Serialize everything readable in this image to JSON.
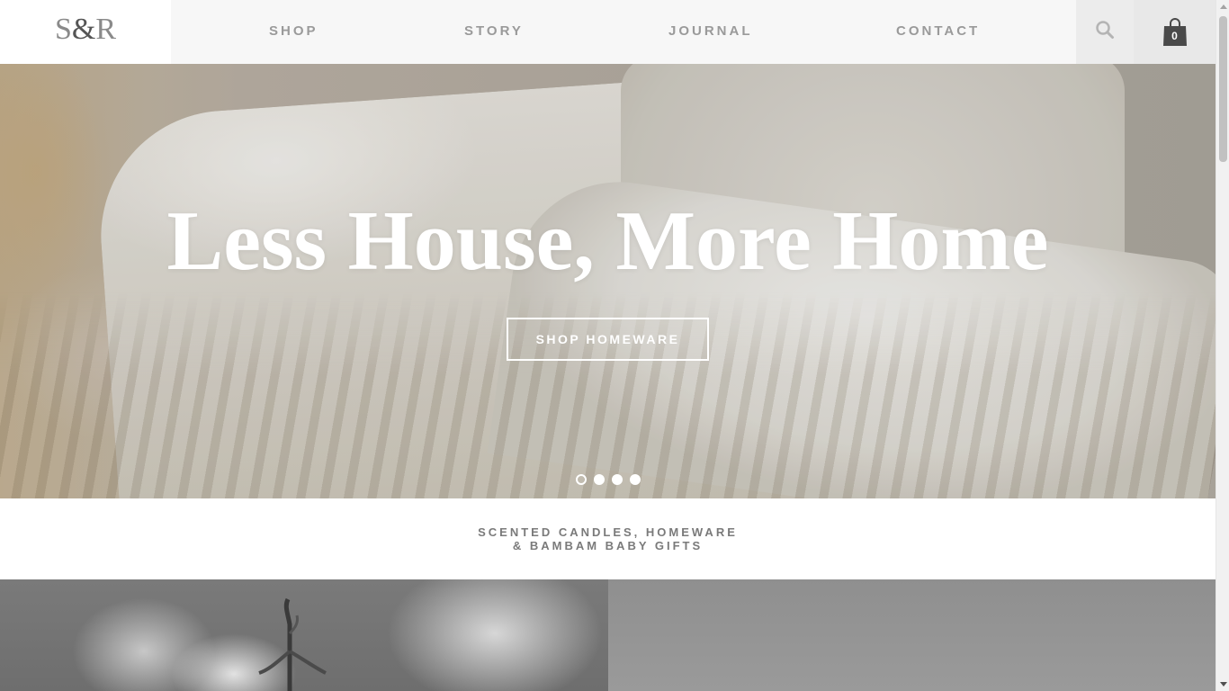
{
  "header": {
    "logo_left": "S",
    "logo_amp": "&",
    "logo_right": "R",
    "nav": [
      {
        "label": "SHOP"
      },
      {
        "label": "STORY"
      },
      {
        "label": "JOURNAL"
      },
      {
        "label": "CONTACT"
      }
    ],
    "search_icon": "search-icon",
    "cart_icon": "shopping-bag-icon",
    "cart_count": "0"
  },
  "hero": {
    "title": "Less House, More Home",
    "cta_label": "SHOP HOMEWARE",
    "slides": 4,
    "active_slide": 1
  },
  "tagline": {
    "line1": "SCENTED CANDLES, HOMEWARE",
    "line2": "& BAMBAM BABY GIFTS"
  },
  "colors": {
    "header_bg": "#f7f7f7",
    "nav_text": "#9a9a9a",
    "tagline_text": "#7a7a7a",
    "cart_bag": "#4a4a4a"
  }
}
